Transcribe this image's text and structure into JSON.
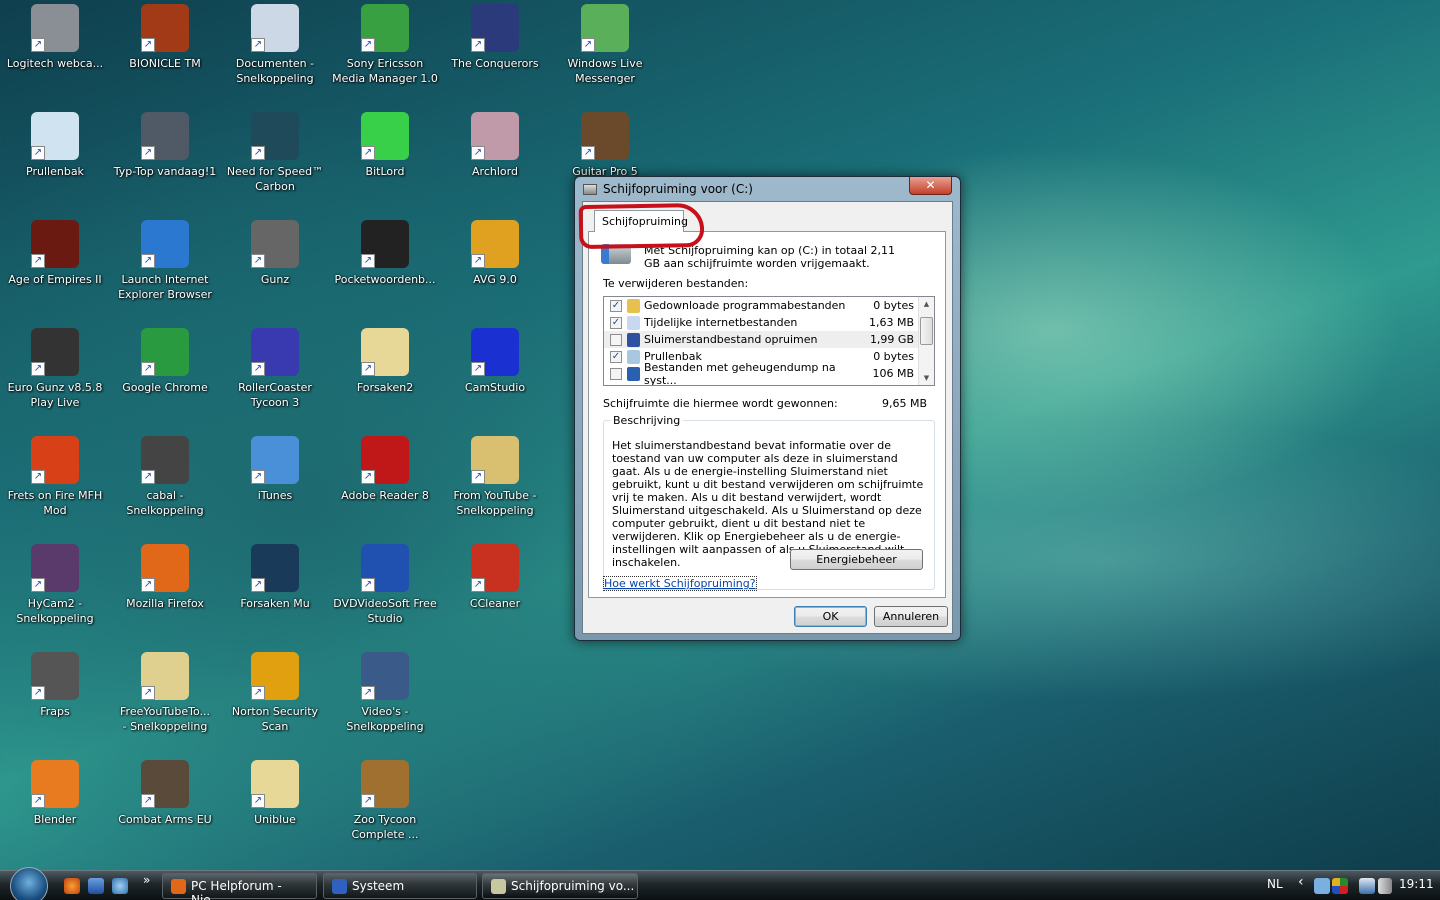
{
  "desktop": {
    "rows": [
      [
        {
          "label": "Logitech webca...",
          "color": "#8a8f96"
        },
        {
          "label": "BIONICLE TM",
          "color": "#a23a18"
        },
        {
          "label": "Documenten -\nSnelkoppeling",
          "color": "#cdd8e6"
        },
        {
          "label": "Sony Ericsson\nMedia Manager 1.0",
          "color": "#38a040"
        },
        {
          "label": "The Conquerors",
          "color": "#2a3a7a"
        },
        {
          "label": "Windows Live\nMessenger",
          "color": "#5ab05a"
        }
      ],
      [
        {
          "label": "Prullenbak",
          "color": "#cfe3f0"
        },
        {
          "label": "Typ-Top vandaag!1",
          "color": "#505a66"
        },
        {
          "label": "Need for Speed™\nCarbon",
          "color": "#1e4a5a"
        },
        {
          "label": "BitLord",
          "color": "#38d048"
        },
        {
          "label": "Archlord",
          "color": "#c09aa8"
        },
        {
          "label": "Guitar Pro 5",
          "color": "#6a4a2a"
        }
      ],
      [
        {
          "label": "Age of Empires II",
          "color": "#6a1a10"
        },
        {
          "label": "Launch Internet\nExplorer Browser",
          "color": "#2a78d0"
        },
        {
          "label": "Gunz",
          "color": "#666"
        },
        {
          "label": "Pocketwoordenb...",
          "color": "#222"
        },
        {
          "label": "AVG 9.0",
          "color": "#e0a020"
        }
      ],
      [
        {
          "label": "Euro Gunz v8.5.8\nPlay Live",
          "color": "#333"
        },
        {
          "label": "Google Chrome",
          "color": "#2a9a40"
        },
        {
          "label": "RollerCoaster\nTycoon 3",
          "color": "#3a3ab0"
        },
        {
          "label": "Forsaken2",
          "color": "#e8d898"
        },
        {
          "label": "CamStudio",
          "color": "#1a30d0"
        }
      ],
      [
        {
          "label": "Frets on Fire MFH\nMod",
          "color": "#d84018"
        },
        {
          "label": "cabal -\nSnelkoppeling",
          "color": "#444"
        },
        {
          "label": "iTunes",
          "color": "#4a90d8"
        },
        {
          "label": "Adobe Reader 8",
          "color": "#c01818"
        },
        {
          "label": "From YouTube -\nSnelkoppeling",
          "color": "#d8c070"
        }
      ],
      [
        {
          "label": "HyCam2 -\nSnelkoppeling",
          "color": "#5a3a6a"
        },
        {
          "label": "Mozilla Firefox",
          "color": "#e06818"
        },
        {
          "label": "Forsaken Mu",
          "color": "#1a3a5a"
        },
        {
          "label": "DVDVideoSoft Free\nStudio",
          "color": "#2050b0"
        },
        {
          "label": "CCleaner",
          "color": "#c83020"
        }
      ],
      [
        {
          "label": "Fraps",
          "color": "#555"
        },
        {
          "label": "FreeYouTubeTo...\n- Snelkoppeling",
          "color": "#e0d090"
        },
        {
          "label": "Norton Security\nScan",
          "color": "#e0a010"
        },
        {
          "label": "Video's -\nSnelkoppeling",
          "color": "#3a5a8a"
        }
      ],
      [
        {
          "label": "Blender",
          "color": "#e87a20"
        },
        {
          "label": "Combat Arms EU",
          "color": "#5a4a3a"
        },
        {
          "label": "Uniblue",
          "color": "#e8d898"
        },
        {
          "label": "Zoo Tycoon\nComplete ...",
          "color": "#a07030"
        }
      ]
    ]
  },
  "dialog": {
    "title": "Schijfopruiming voor  (C:)",
    "close": "✕",
    "tab": "Schijfopruiming",
    "intro": "Met Schijfopruiming kan op  (C:) in totaal 2,11 GB aan schijfruimte worden vrijgemaakt.",
    "list_label": "Te verwijderen bestanden:",
    "items": [
      {
        "name": "Gedownloade programmabestanden",
        "size": "0 bytes",
        "checked": true,
        "color": "#e8c050"
      },
      {
        "name": "Tijdelijke internetbestanden",
        "size": "1,63 MB",
        "checked": true,
        "color": "#c8d8f0"
      },
      {
        "name": "Sluimerstandbestand opruimen",
        "size": "1,99 GB",
        "checked": false,
        "color": "#3050a0"
      },
      {
        "name": "Prullenbak",
        "size": "0 bytes",
        "checked": true,
        "color": "#a8c8e0"
      },
      {
        "name": "Bestanden met geheugendump na syst...",
        "size": "106 MB",
        "checked": false,
        "color": "#2a60b0"
      }
    ],
    "gain_label": "Schijfruimte die hiermee wordt gewonnen:",
    "gain_value": "9,65 MB",
    "desc_legend": "Beschrijving",
    "description": "Het sluimerstandbestand bevat informatie over de toestand van uw computer als deze in sluimerstand gaat. Als u de energie-instelling Sluimerstand niet gebruikt, kunt u dit bestand verwijderen om schijfruimte vrij te maken. Als u dit bestand verwijdert, wordt Sluimerstand uitgeschakeld. Als u Sluimerstand op deze computer gebruikt, dient u dit bestand niet te verwijderen. Klik op Energiebeheer als u de energie-instellingen wilt aanpassen of als u Sluimerstand wilt inschakelen.",
    "power_button": "Energiebeheer",
    "help_link": "Hoe werkt Schijfopruiming?",
    "ok": "OK",
    "cancel": "Annuleren"
  },
  "taskbar": {
    "chevron": "»",
    "tasks": [
      {
        "label": "PC Helpforum - Nie...",
        "color": "#e06818"
      },
      {
        "label": "Systeem",
        "color": "#3060c0"
      },
      {
        "label": "Schijfopruiming vo...",
        "color": "#c8c8a0"
      }
    ],
    "language": "NL",
    "tray_expand": "‹",
    "clock": "19:11"
  }
}
